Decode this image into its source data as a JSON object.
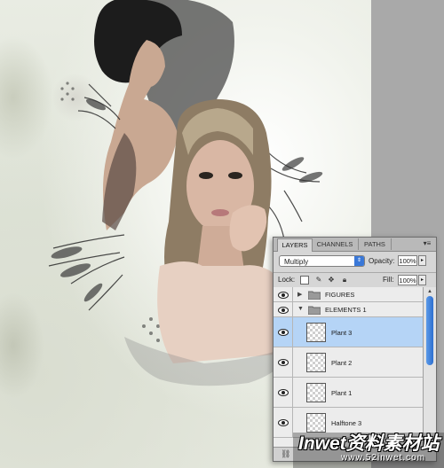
{
  "panel": {
    "tabs": [
      "LAYERS",
      "CHANNELS",
      "PATHS"
    ],
    "menu_icon": "panel-menu-icon",
    "blend_mode": "Multiply",
    "opacity_label": "Opacity:",
    "opacity_value": "100%",
    "lock_label": "Lock:",
    "fill_label": "Fill:",
    "fill_value": "100%",
    "layers": [
      {
        "name": "FIGURES",
        "type": "group",
        "expanded": false
      },
      {
        "name": "ELEMENTS 1",
        "type": "group",
        "expanded": true
      },
      {
        "name": "Plant 3",
        "type": "layer",
        "selected": true
      },
      {
        "name": "Plant 2",
        "type": "layer",
        "selected": false
      },
      {
        "name": "Plant 1",
        "type": "layer",
        "selected": false
      },
      {
        "name": "Halftone 3",
        "type": "layer",
        "selected": false
      }
    ]
  },
  "watermark": {
    "main": "Inwet资料素材站",
    "url": "www.52inwet.com"
  },
  "colors": {
    "selected_row": "#b5d4f6",
    "accent_blue": "#3a78d8"
  }
}
